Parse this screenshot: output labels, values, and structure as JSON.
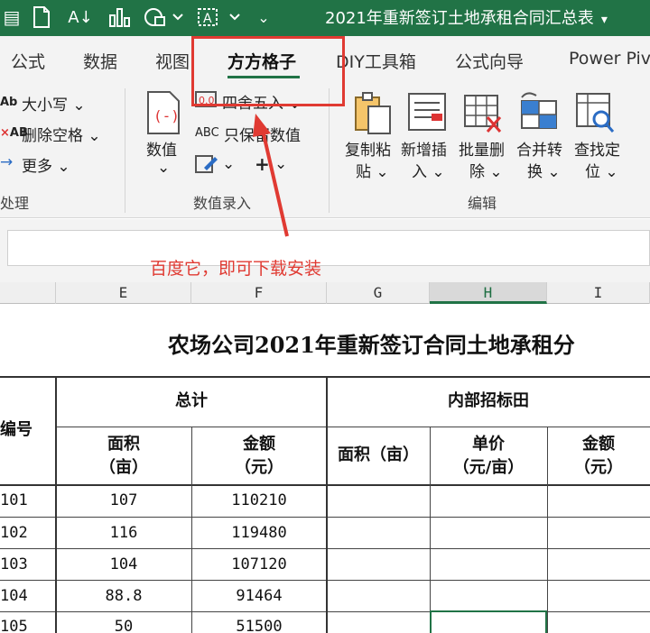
{
  "window": {
    "title": "2021年重新签订土地承租合同汇总表",
    "title_caret": "▾"
  },
  "tabs": [
    {
      "label": "公式",
      "active": false
    },
    {
      "label": "数据",
      "active": false
    },
    {
      "label": "视图",
      "active": false
    },
    {
      "label": "方方格子",
      "active": true
    },
    {
      "label": "DIY工具箱",
      "active": false
    },
    {
      "label": "公式向导",
      "active": false
    },
    {
      "label": "Power Piv",
      "active": false
    }
  ],
  "ribbon": {
    "text_group": {
      "case_label": "大小写",
      "trim_label": "删除空格",
      "more_label": "更多",
      "group_label": "处理"
    },
    "number_group": {
      "numeric_line1": "数值",
      "round_label": "四舍五入",
      "keep_values_label": "只保留数值",
      "abc_prefix": "ABC",
      "group_label": "数值录入"
    },
    "edit_group": {
      "copy_paste": [
        "复制粘",
        "贴"
      ],
      "add_insert": [
        "新增插",
        "入"
      ],
      "batch_delete": [
        "批量删",
        "除"
      ],
      "merge_convert": [
        "合并转",
        "换"
      ],
      "find_locate": [
        "查找定",
        "位"
      ],
      "group_label": "编辑"
    }
  },
  "annotation": {
    "text": "百度它，即可下载安装",
    "color": "#e03a32"
  },
  "columns": [
    "E",
    "F",
    "G",
    "H",
    "I"
  ],
  "sheet": {
    "title": "农场公司2021年重新签订合同土地承租分",
    "header_id": "编号",
    "header_total": "总计",
    "header_internal": "内部招标田",
    "sub_area": [
      "面积",
      "（亩）"
    ],
    "sub_amount": [
      "金额",
      "（元）"
    ],
    "sub_area_inline": "面积（亩）",
    "sub_unit_price": [
      "单价",
      "（元/亩）"
    ],
    "sub_amount2": [
      "金额",
      "（元）"
    ],
    "rows": [
      {
        "id": "101",
        "area": "107",
        "amount": "110210"
      },
      {
        "id": "102",
        "area": "116",
        "amount": "119480"
      },
      {
        "id": "103",
        "area": "104",
        "amount": "107120"
      },
      {
        "id": "104",
        "area": "88.8",
        "amount": "91464"
      },
      {
        "id": "105",
        "area": "50",
        "amount": "51500"
      }
    ]
  },
  "colors": {
    "excel_green": "#217346",
    "annotation_red": "#e03a32"
  }
}
